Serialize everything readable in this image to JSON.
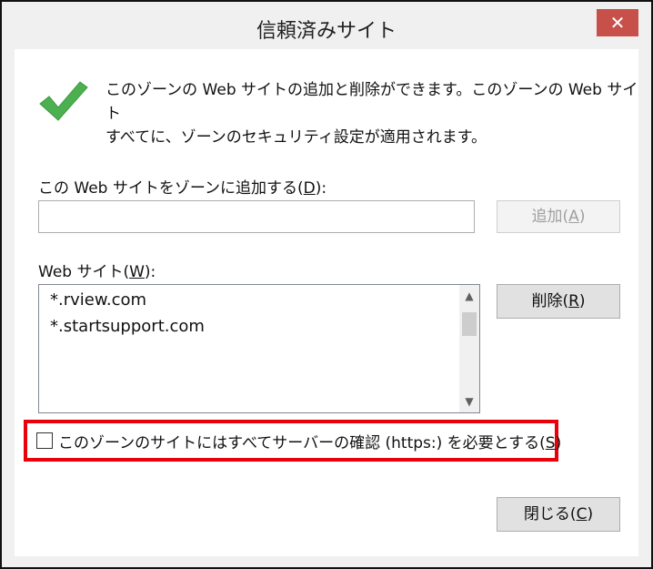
{
  "window": {
    "title": "信頼済みサイト",
    "close_glyph": "✕"
  },
  "description": {
    "line1": "このゾーンの Web サイトの追加と削除ができます。このゾーンの Web サイト",
    "line2": "すべてに、ゾーンのセキュリティ設定が適用されます。"
  },
  "add_site": {
    "label_prefix": "この Web サイトをゾーンに追加する(",
    "label_key": "D",
    "label_suffix": "):",
    "input_value": "",
    "button_prefix": "追加(",
    "button_key": "A",
    "button_suffix": ")"
  },
  "websites": {
    "label_prefix": "Web サイト(",
    "label_key": "W",
    "label_suffix": "):",
    "items": [
      "*.rview.com",
      "*.startsupport.com"
    ],
    "remove_prefix": "削除(",
    "remove_key": "R",
    "remove_suffix": ")"
  },
  "https_option": {
    "label_prefix": "このゾーンのサイトにはすべてサーバーの確認 (https:) を必要とする(",
    "label_key": "S",
    "label_suffix": ")",
    "checked": false
  },
  "close_button": {
    "prefix": "閉じる(",
    "key": "C",
    "suffix": ")"
  },
  "colors": {
    "highlight": "#e8000b",
    "checkmark": "#4caf50",
    "close_button_bg": "#c7504b"
  }
}
